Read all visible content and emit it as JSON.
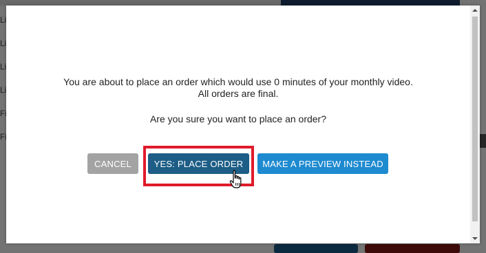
{
  "background": {
    "sidebar_items": [
      "Li",
      "Li",
      "Li",
      "Li",
      "Fi",
      "Fi"
    ]
  },
  "dialog": {
    "message_line1": "You are about to place an order which would use 0 minutes of your monthly video.",
    "message_line2": "All orders are final.",
    "question": "Are you sure you want to place an order?",
    "buttons": {
      "cancel": "CANCEL",
      "place_order": "YES: PLACE ORDER",
      "preview": "MAKE A PREVIEW INSTEAD"
    }
  },
  "colors": {
    "cancel_bg": "#a3a3a3",
    "place_bg": "#1d5d86",
    "preview_bg": "#1e8ad0",
    "highlight": "#e01b2b"
  },
  "icons": {
    "cursor": "hand-pointer-icon",
    "scroll_up": "chevron-up-icon",
    "scroll_down": "chevron-down-icon"
  }
}
